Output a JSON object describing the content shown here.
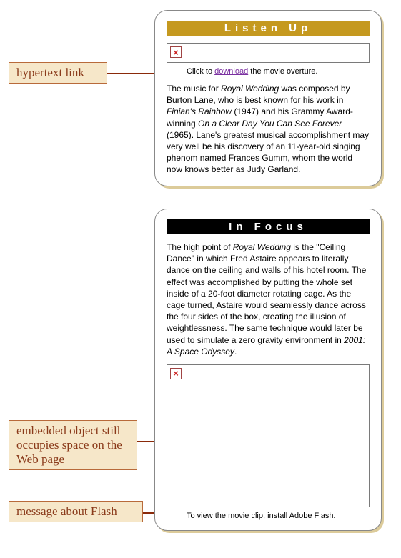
{
  "callouts": {
    "hyperlink": "hypertext link",
    "embedded": "embedded object still occupies space on the Web page",
    "flash": "message about Flash"
  },
  "listen_up": {
    "title": "Listen Up",
    "caption_prefix": "Click to ",
    "link_text": "download",
    "caption_suffix": " the movie overture.",
    "body_pre": "The music for ",
    "body_em1": "Royal Wedding",
    "body_mid1": " was composed by Burton Lane, who is best known for his work in ",
    "body_em2": "Finian's Rainbow",
    "body_mid2": " (1947) and his Grammy Award-winning ",
    "body_em3": "On a Clear Day You Can See Forever",
    "body_end": " (1965). Lane's greatest musical accomplishment may very well be his discovery of an 11-year-old singing phenom named Frances Gumm, whom the world now knows better as Judy Garland."
  },
  "in_focus": {
    "title": "In Focus",
    "body_pre": "The high point of ",
    "body_em1": "Royal Wedding",
    "body_mid": " is the \"Ceiling Dance\" in which Fred Astaire appears to literally dance on the ceiling and walls of his hotel room. The effect was accomplished by putting the whole set inside of a 20-foot diameter rotating cage. As the cage turned, Astaire would seamlessly dance across the four sides of the box, creating the illusion of weightlessness. The same technique would later be used to simulate a zero gravity environment in ",
    "body_em2": "2001: A Space Odyssey",
    "body_end": ".",
    "flash_msg": "To view the movie clip, install Adobe Flash."
  },
  "icons": {
    "broken": "×"
  }
}
